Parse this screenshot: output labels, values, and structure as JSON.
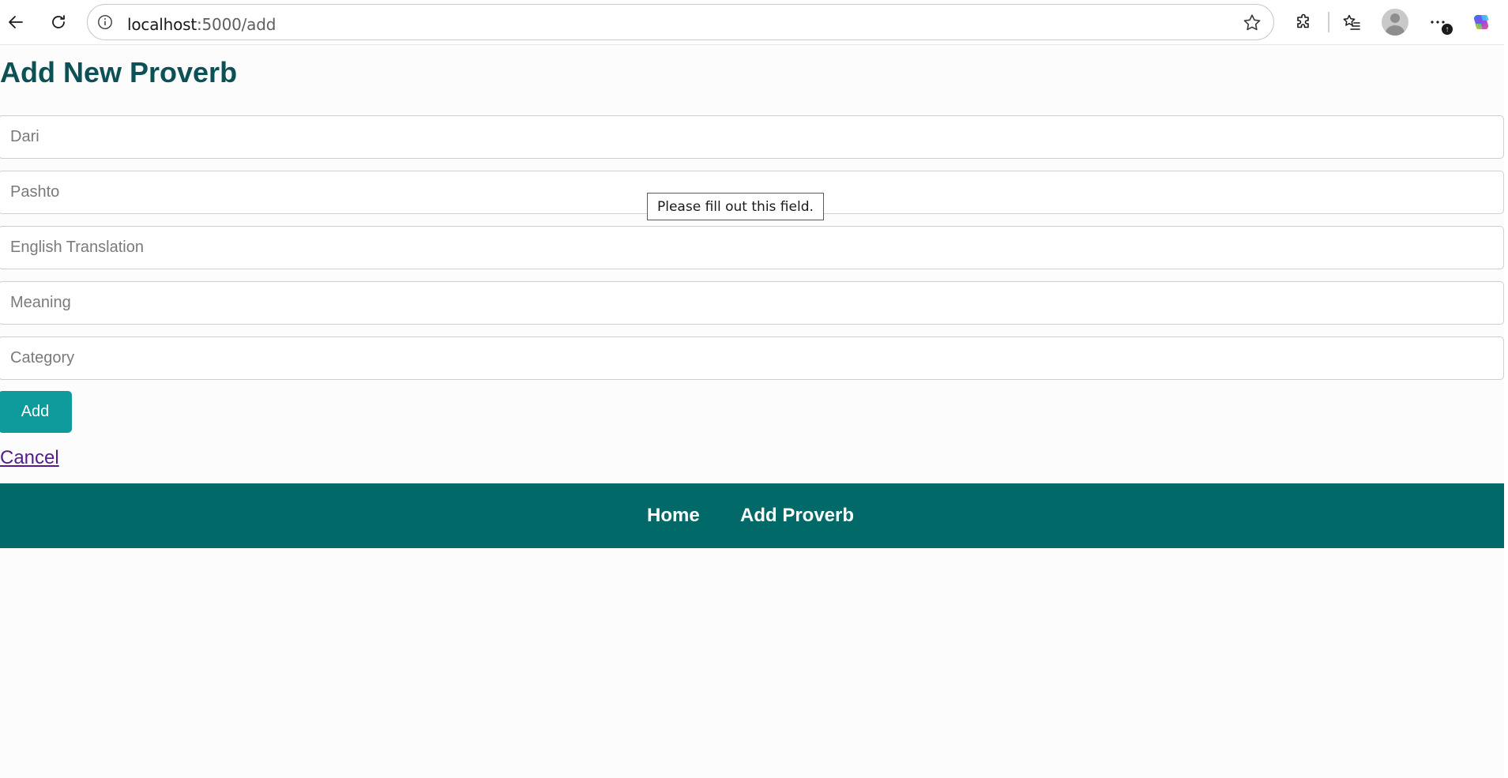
{
  "browser": {
    "url_host": "localhost",
    "url_path": ":5000/add",
    "icons": {
      "back": "back-arrow-icon",
      "reload": "reload-icon",
      "site_info": "info-icon",
      "favorite": "star-icon",
      "extensions": "puzzle-icon",
      "favorites": "favorites-list-icon",
      "profile": "profile-avatar-icon",
      "more": "more-dots-icon",
      "copilot": "copilot-icon"
    },
    "more_badge": "↑"
  },
  "page": {
    "title": "Add New Proverb",
    "form": {
      "fields": [
        {
          "name": "dari",
          "placeholder": "Dari",
          "value": ""
        },
        {
          "name": "pashto",
          "placeholder": "Pashto",
          "value": ""
        },
        {
          "name": "english",
          "placeholder": "English Translation",
          "value": ""
        },
        {
          "name": "meaning",
          "placeholder": "Meaning",
          "value": ""
        },
        {
          "name": "category",
          "placeholder": "Category",
          "value": ""
        }
      ],
      "submit_label": "Add",
      "cancel_label": "Cancel"
    },
    "validation_tooltip": "Please fill out this field.",
    "footer": {
      "links": [
        {
          "label": "Home"
        },
        {
          "label": "Add Proverb"
        }
      ]
    }
  },
  "colors": {
    "title": "#0b5156",
    "button": "#0f9a9b",
    "footer": "#016a68",
    "link_visited": "#551a8b"
  }
}
